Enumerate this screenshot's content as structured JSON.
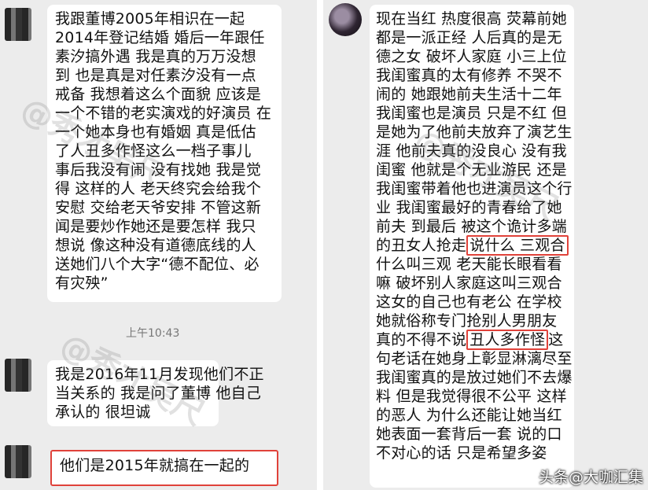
{
  "left": {
    "message1": [
      "我跟董博2005年相识在一起",
      "2014年登记结婚  婚后一年跟任",
      "素汐搞外遇 我是真的万万没想",
      "到 也是真是对任素汐没有一点",
      "戒备 我想着这么个面貌 应该是",
      "一个不错的老实演戏的好演员 在",
      "一个她本身也有婚姻 真是低估",
      "了人丑多作怪这么一档子事儿",
      "事后我没有闹 没有找她 我是觉",
      "得 这样的人 老天终究会给我个",
      "安慰 交给老天爷安排 不管这新",
      "闻是要炒作她还是要怎样 我只",
      "想说 像这种没有道德底线的人",
      "送她们八个大字“德不配位、必",
      "有灾殃”"
    ],
    "time": "上午10:43",
    "message2": [
      "我是2016年11月发现他们不正",
      "当关系的 我是问了董博 他自己",
      "承认的 很坦诚"
    ],
    "message3": "他们是2015年就搞在一起的"
  },
  "right": {
    "lines_before": [
      "现在当红 热度很高 荧幕前她",
      "都是一派正经 人后真的是无",
      "德之女 破坏人家庭 小三上位",
      "我闺蜜真的太有修养 不哭不",
      "闹的 她跟她前夫生活十二年",
      "我闺蜜也是演员 只是不红 但",
      "是她为了他前夫放弃了演艺生",
      "涯 他前夫真的没良心 没有我",
      "闺蜜 他就是个无业游民 还是",
      "我闺蜜带着他也进演员这个行",
      "业 我闺蜜最好的青春给了她",
      "前夫 到最后 被这个诡计多端"
    ],
    "line_hl1_pre": "的丑女人抢走",
    "line_hl1": "说什么 三观合",
    "lines_mid": [
      "什么叫三观 老天能长眼看看",
      "嘛 破坏别人家庭这叫三观合",
      "这女的自己也有老公 在学校",
      "她就俗称专门抢别人男朋友"
    ],
    "line_hl2_pre": "真的不得不说",
    "line_hl2": "丑人多作怪",
    "line_hl2_post": "这",
    "lines_after": [
      "句老话在她身上彰显淋漓尽至",
      "我闺蜜真的是放过她们不去爆",
      "料 但是我觉得很不公平 这样",
      "的恶人 为什么还能让她当红",
      "她表面一套背后一套 说的口",
      "不对心的话 只是希望多姿"
    ]
  },
  "watermarks": [
    "@秀才吴尺",
    "@秀才吴尺",
    "@秀才吴尺"
  ],
  "corner_watermark": "头条@大咖汇集",
  "colors": {
    "highlight": "#e0423a",
    "background": "#ececec",
    "bubble": "#ffffff"
  }
}
